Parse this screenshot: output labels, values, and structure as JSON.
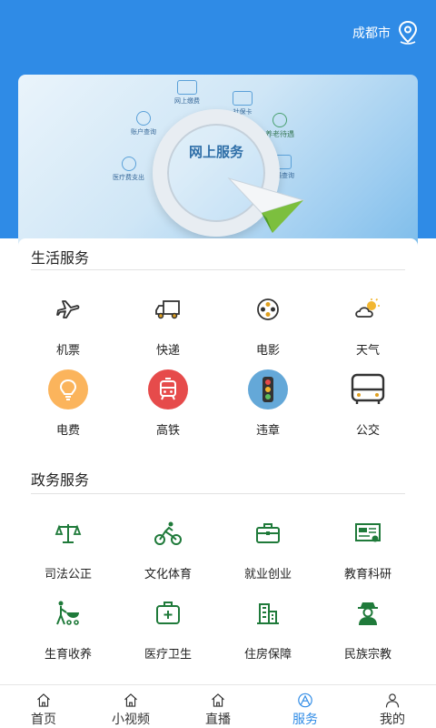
{
  "header": {
    "city": "成都市",
    "city_icon": "location-pin-icon",
    "bg_color": "#2f8be6"
  },
  "banner": {
    "center_text": "网上服务",
    "items": [
      "网上缴费",
      "社保卡",
      "养老待遇",
      "医疗费支出",
      "账户查询",
      "待遇查询"
    ]
  },
  "life_services": {
    "title": "生活服务",
    "items": [
      {
        "label": "机票",
        "icon": "airplane-icon"
      },
      {
        "label": "快递",
        "icon": "delivery-truck-icon"
      },
      {
        "label": "电影",
        "icon": "film-reel-icon"
      },
      {
        "label": "天气",
        "icon": "weather-icon"
      },
      {
        "label": "电费",
        "icon": "light-bulb-icon"
      },
      {
        "label": "高铁",
        "icon": "train-icon"
      },
      {
        "label": "违章",
        "icon": "traffic-light-icon"
      },
      {
        "label": "公交",
        "icon": "bus-icon"
      }
    ]
  },
  "gov_services": {
    "title": "政务服务",
    "items": [
      {
        "label": "司法公正",
        "icon": "scales-icon"
      },
      {
        "label": "文化体育",
        "icon": "cyclist-icon"
      },
      {
        "label": "就业创业",
        "icon": "briefcase-icon"
      },
      {
        "label": "教育科研",
        "icon": "certificate-icon"
      },
      {
        "label": "生育收养",
        "icon": "stroller-icon"
      },
      {
        "label": "医疗卫生",
        "icon": "medical-kit-icon"
      },
      {
        "label": "住房保障",
        "icon": "building-icon"
      },
      {
        "label": "民族宗教",
        "icon": "person-hat-icon"
      }
    ]
  },
  "tabbar": {
    "active_color": "#2f8be6",
    "tabs": [
      {
        "label": "首页",
        "icon": "home-icon"
      },
      {
        "label": "小视频",
        "icon": "home-icon"
      },
      {
        "label": "直播",
        "icon": "home-icon"
      },
      {
        "label": "服务",
        "icon": "service-icon",
        "active": true
      },
      {
        "label": "我的",
        "icon": "user-icon"
      }
    ]
  }
}
